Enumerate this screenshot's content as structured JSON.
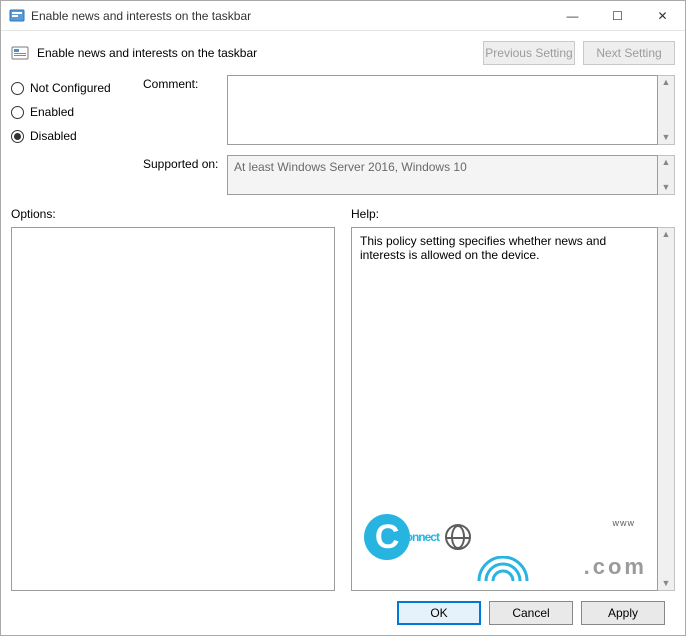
{
  "window": {
    "title": "Enable news and interests on the taskbar",
    "minimize": "—",
    "maximize": "☐",
    "close": "✕"
  },
  "header": {
    "title": "Enable news and interests on the taskbar",
    "prev": "Previous Setting",
    "next": "Next Setting"
  },
  "radios": {
    "not_configured": "Not Configured",
    "enabled": "Enabled",
    "disabled": "Disabled",
    "selected": "disabled"
  },
  "fields": {
    "comment_label": "Comment:",
    "comment_value": "",
    "supported_label": "Supported on:",
    "supported_value": "At least Windows Server 2016, Windows 10"
  },
  "panes": {
    "options_label": "Options:",
    "options_value": "",
    "help_label": "Help:",
    "help_value": "This policy setting specifies whether news and interests is allowed on the device."
  },
  "footer": {
    "ok": "OK",
    "cancel": "Cancel",
    "apply": "Apply"
  },
  "watermark": {
    "brand": "onnect",
    "www": "www",
    "com": ".com"
  }
}
